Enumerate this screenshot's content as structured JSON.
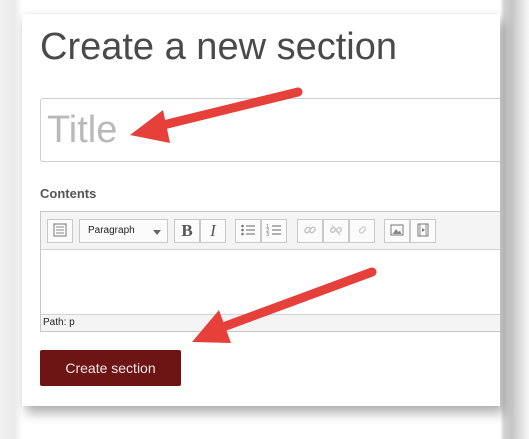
{
  "page": {
    "title": "Create a new section"
  },
  "form": {
    "title_placeholder": "Title",
    "title_value": "",
    "contents_label": "Contents",
    "submit_label": "Create section"
  },
  "editor": {
    "format_select": "Paragraph",
    "status_path": "Path: p",
    "bold_glyph": "B",
    "italic_glyph": "I",
    "toolbar_icons": [
      "toggle-toolbar-icon",
      "bold-icon",
      "italic-icon",
      "bullet-list-icon",
      "numbered-list-icon",
      "link-icon",
      "unlink-icon",
      "anchor-icon",
      "image-icon",
      "media-icon"
    ]
  },
  "colors": {
    "submit_bg": "#6d1414",
    "arrow": "#e5403a"
  }
}
